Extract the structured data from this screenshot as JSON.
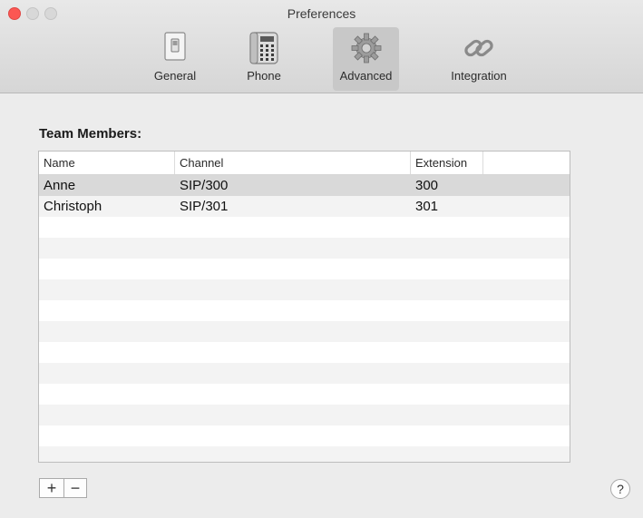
{
  "window": {
    "title": "Preferences"
  },
  "toolbar": {
    "items": [
      {
        "label": "General",
        "icon": "switch-icon",
        "selected": false
      },
      {
        "label": "Phone",
        "icon": "phone-icon",
        "selected": false
      },
      {
        "label": "Advanced",
        "icon": "gear-icon",
        "selected": true
      },
      {
        "label": "Integration",
        "icon": "chain-link-icon",
        "selected": false
      }
    ]
  },
  "team": {
    "title": "Team Members:",
    "columns": [
      "Name",
      "Channel",
      "Extension"
    ],
    "rows": [
      {
        "name": "Anne",
        "channel": "SIP/300",
        "extension": "300"
      },
      {
        "name": "Christoph",
        "channel": "SIP/301",
        "extension": "301"
      }
    ]
  },
  "controls": {
    "add_label": "+",
    "remove_label": "−",
    "help_label": "?"
  }
}
